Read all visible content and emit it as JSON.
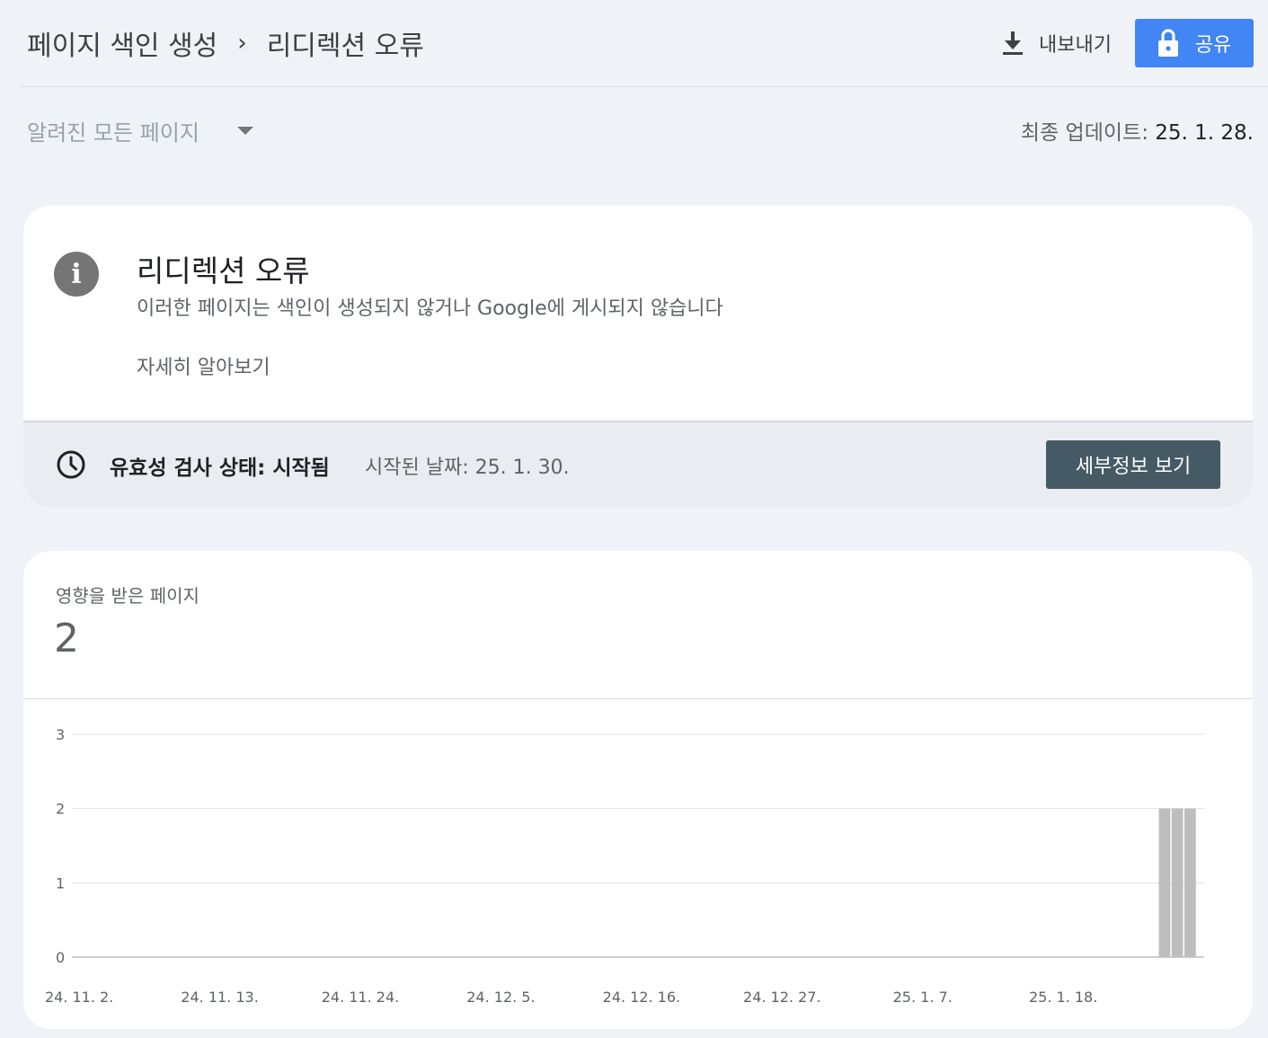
{
  "header": {
    "breadcrumb": [
      "페이지 색인 생성",
      "리디렉션 오류"
    ],
    "separator": "›",
    "export_label": "내보내기",
    "share_label": "공유"
  },
  "filter": {
    "selected": "알려진 모든 페이지",
    "last_update_label": "최종 업데이트:",
    "last_update_date": "25. 1. 28."
  },
  "issue": {
    "title": "리디렉션 오류",
    "description": "이러한 페이지는 색인이 생성되지 않거나 Google에 게시되지 않습니다",
    "learn_more": "자세히 알아보기",
    "validation_status": "유효성 검사 상태: 시작됨",
    "validation_started": "시작된 날짜: 25. 1. 30.",
    "details_button": "세부정보 보기"
  },
  "metric": {
    "label": "영향을 받은 페이지",
    "value": "2"
  },
  "colors": {
    "accent": "#4285f4",
    "details_button": "#455a64",
    "bar": "#bdbdbd",
    "background": "#eff3f8"
  },
  "chart_data": {
    "type": "bar",
    "title": "",
    "xlabel": "",
    "ylabel": "",
    "ylim": [
      0,
      3
    ],
    "yticks": [
      0,
      1,
      2,
      3
    ],
    "xtick_labels": [
      "24. 11. 2.",
      "24. 11. 13.",
      "24. 11. 24.",
      "24. 12. 5.",
      "24. 12. 16.",
      "24. 12. 27.",
      "25. 1. 7.",
      "25. 1. 18."
    ],
    "start_date": "2024-11-02",
    "end_date": "2025-01-28",
    "bars": [
      {
        "date": "2025-01-26",
        "value": 2
      },
      {
        "date": "2025-01-27",
        "value": 2
      },
      {
        "date": "2025-01-28",
        "value": 2
      }
    ]
  }
}
